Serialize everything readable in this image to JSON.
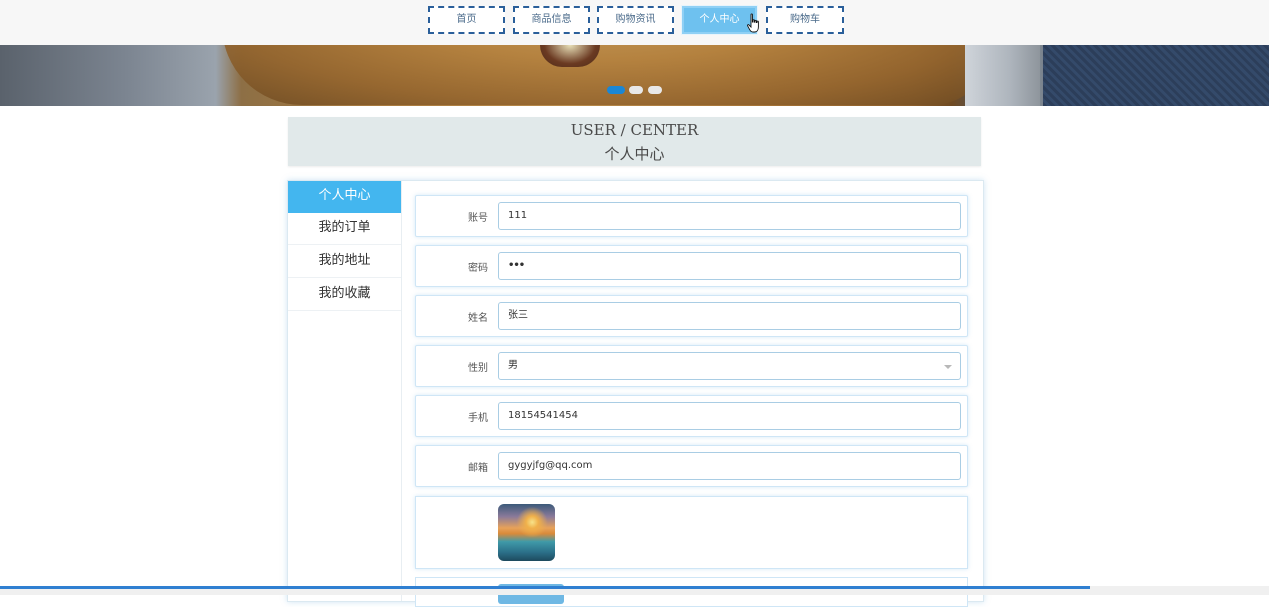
{
  "nav": {
    "items": [
      {
        "label": "首页"
      },
      {
        "label": "商品信息"
      },
      {
        "label": "购物资讯"
      },
      {
        "label": "个人中心"
      },
      {
        "label": "购物车"
      }
    ],
    "active_index": 3
  },
  "banner": {
    "slide_count": 3,
    "active_slide": 1
  },
  "section": {
    "title_en": "USER / CENTER",
    "title_cn": "个人中心"
  },
  "sidebar": {
    "items": [
      {
        "label": "个人中心"
      },
      {
        "label": "我的订单"
      },
      {
        "label": "我的地址"
      },
      {
        "label": "我的收藏"
      }
    ],
    "active_index": 0
  },
  "form": {
    "account": {
      "label": "账号",
      "value": "111"
    },
    "password": {
      "label": "密码",
      "value": "•••"
    },
    "name": {
      "label": "姓名",
      "value": "张三"
    },
    "gender": {
      "label": "性别",
      "value": "男"
    },
    "phone": {
      "label": "手机",
      "value": "18154541454"
    },
    "email": {
      "label": "邮箱",
      "value": "gygyjfg@qq.com"
    }
  },
  "colors": {
    "nav_border": "#2a5f9a",
    "nav_active": "#6ec1ef",
    "sidebar_active": "#43b6ef",
    "dot_active": "#1a87d6",
    "section_bg": "#e1e9ea"
  },
  "icons": {
    "cursor": "hand-pointer-icon",
    "select_caret": "chevron-down-icon"
  }
}
